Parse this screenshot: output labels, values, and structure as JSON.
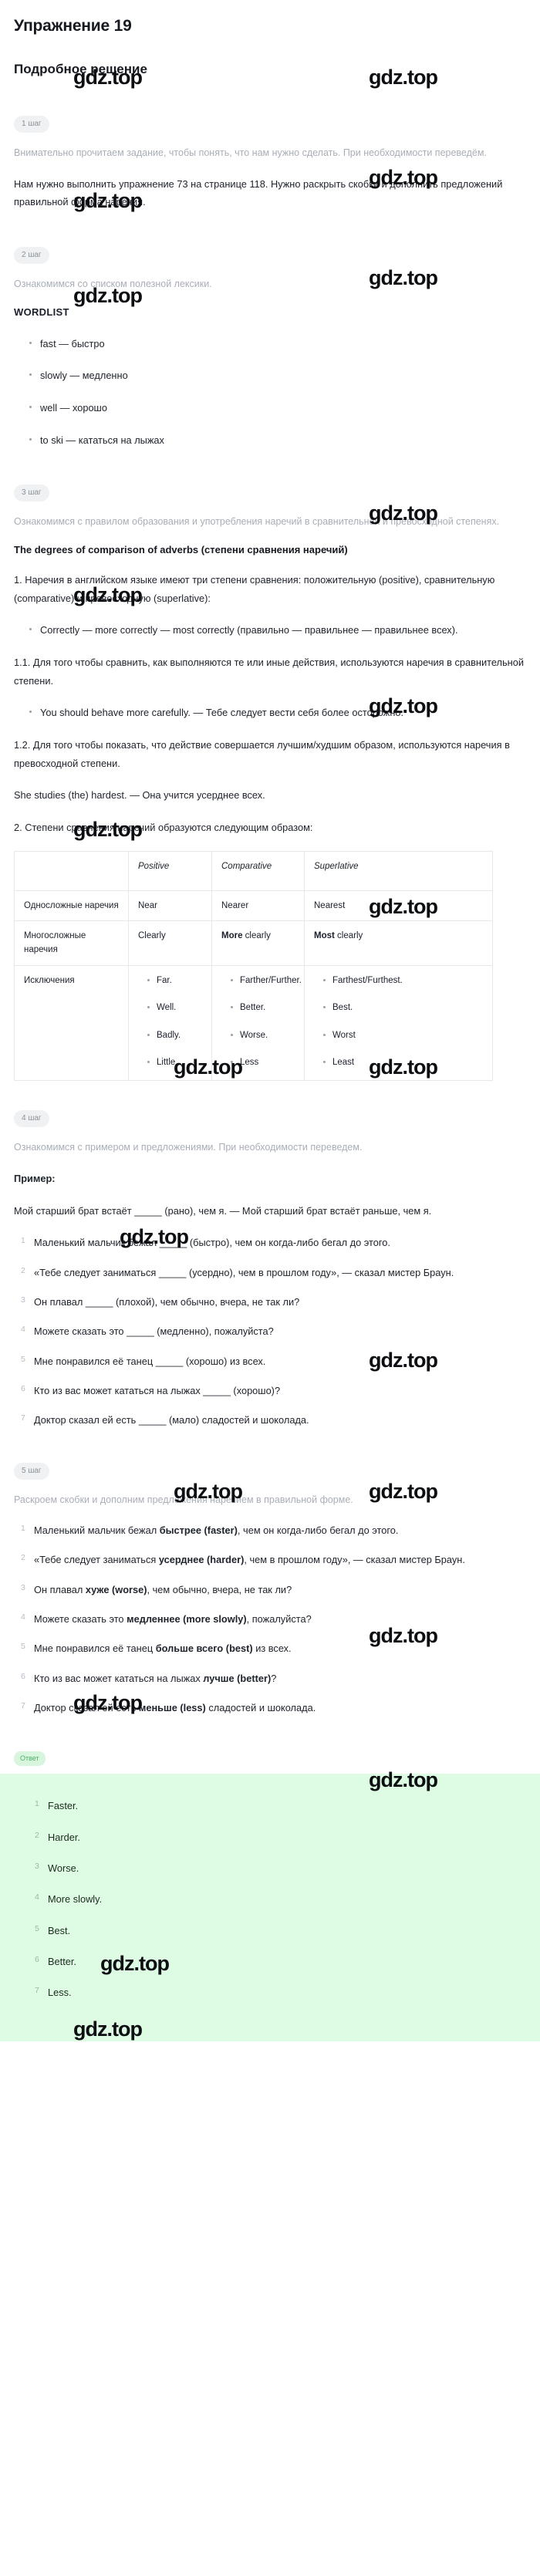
{
  "exercise_title": "Упражнение 19",
  "solution_title": "Подробное решение",
  "watermark": "gdz.top",
  "steps": {
    "s1": {
      "chip": "1 шаг",
      "intro": "Внимательно прочитаем задание, чтобы понять, что нам нужно сделать. При необходимости переведём.",
      "task": "Нам нужно выполнить упражнение 73 на странице 118. Нужно раскрыть скобки и дополнить предложений правильной форма наречия."
    },
    "s2": {
      "chip": "2 шаг",
      "intro": "Ознакомимся со списком полезной лексики.",
      "wordlist_title": "WORDLIST",
      "words": [
        "fast — быстро",
        "slowly — медленно",
        "well — хорошо",
        "to ski — кататься на лыжах"
      ]
    },
    "s3": {
      "chip": "3 шаг",
      "intro": "Ознакомимся с правилом образования и употребления наречий в сравнительной и превосходной степенях.",
      "rule_title": "The degrees of comparison of adverbs (степени сравнения наречий)",
      "p1": "1. Наречия в английском языке имеют три степени сравнения: положительную (positive), сравнительную (comparative) и превосходную (superlative):",
      "bullet1": "Correctly — more correctly — most correctly (правильно — правильнее — правильнее всех).",
      "p2": "1.1. Для того чтобы сравнить, как выполняются те или иные действия, используются наречия в сравнительной степени.",
      "bullet2": "You should behave more carefully. — Тебе следует вести себя более осторожно.",
      "p3": "1.2. Для того чтобы показать, что действие совершается лучшим/худшим образом, используются наречия в превосходной степени.",
      "p4": "She studies (the) hardest. — Она учится усерднее всех.",
      "p5": "2. Степени сравнения наречий образуются следующим образом:"
    },
    "s4": {
      "chip": "4 шаг",
      "intro": "Ознакомимся с примером и предложениями. При необходимости переведем.",
      "example_title": "Пример:",
      "example": "Мой старший брат встаёт _____ (рано), чем я. — Мой старший брат встаёт раньше, чем я.",
      "items": [
        "Маленький мальчик бежал _____ (быстро), чем он когда-либо бегал до этого.",
        "«Тебе следует заниматься _____ (усердно), чем в прошлом году», — сказал мистер Браун.",
        "Он плавал _____ (плохой), чем обычно, вчера, не так ли?",
        "Можете сказать это _____ (медленно), пожалуйста?",
        "Мне понравился её танец _____ (хорошо) из всех.",
        "Кто из вас может кататься на лыжах _____ (хорошо)?",
        "Доктор сказал ей есть _____ (мало) сладостей и шоколада."
      ]
    },
    "s5": {
      "chip": "5 шаг",
      "intro": "Раскроем скобки и дополним предложения наречием в правильной форме.",
      "items": [
        {
          "pre": "Маленький мальчик бежал ",
          "bold": "быстрее (faster)",
          "post": ", чем он когда-либо бегал до этого."
        },
        {
          "pre": "«Тебе следует заниматься ",
          "bold": "усерднее (harder)",
          "post": ", чем в прошлом году», — сказал мистер Браун."
        },
        {
          "pre": "Он плавал ",
          "bold": "хуже (worse)",
          "post": ", чем обычно, вчера, не так ли?"
        },
        {
          "pre": "Можете сказать это ",
          "bold": "медленнее (more slowly)",
          "post": ", пожалуйста?"
        },
        {
          "pre": "Мне понравился её танец ",
          "bold": "больше всего (best)",
          "post": " из всех."
        },
        {
          "pre": "Кто из вас может кататься на лыжах ",
          "bold": "лучше (better)",
          "post": "?"
        },
        {
          "pre": "Доктор сказал ей есть ",
          "bold": "меньше (less)",
          "post": " сладостей и шоколада."
        }
      ]
    }
  },
  "table": {
    "headers": [
      "",
      "Positive",
      "Comparative",
      "Superlative"
    ],
    "rows": [
      {
        "label": "Односложные наречия",
        "positive": "Near",
        "comparative": "Nearer",
        "superlative": "Nearest"
      },
      {
        "label": "Многосложные наречия",
        "positive": "Clearly",
        "comparative_bold": "More",
        "comparative_rest": " clearly",
        "superlative_bold": "Most",
        "superlative_rest": " clearly"
      }
    ],
    "exceptions": {
      "label": "Исключения",
      "positive": [
        "Far.",
        "Well.",
        "Badly.",
        "Little"
      ],
      "comparative": [
        "Farther/Further.",
        "Better.",
        "Worse.",
        "Less"
      ],
      "superlative": [
        "Farthest/Furthest.",
        "Best.",
        "Worst",
        "Least"
      ]
    }
  },
  "answer": {
    "chip": "Ответ",
    "items": [
      "Faster.",
      "Harder.",
      "Worse.",
      "More slowly.",
      "Best.",
      "Better.",
      "Less."
    ]
  }
}
